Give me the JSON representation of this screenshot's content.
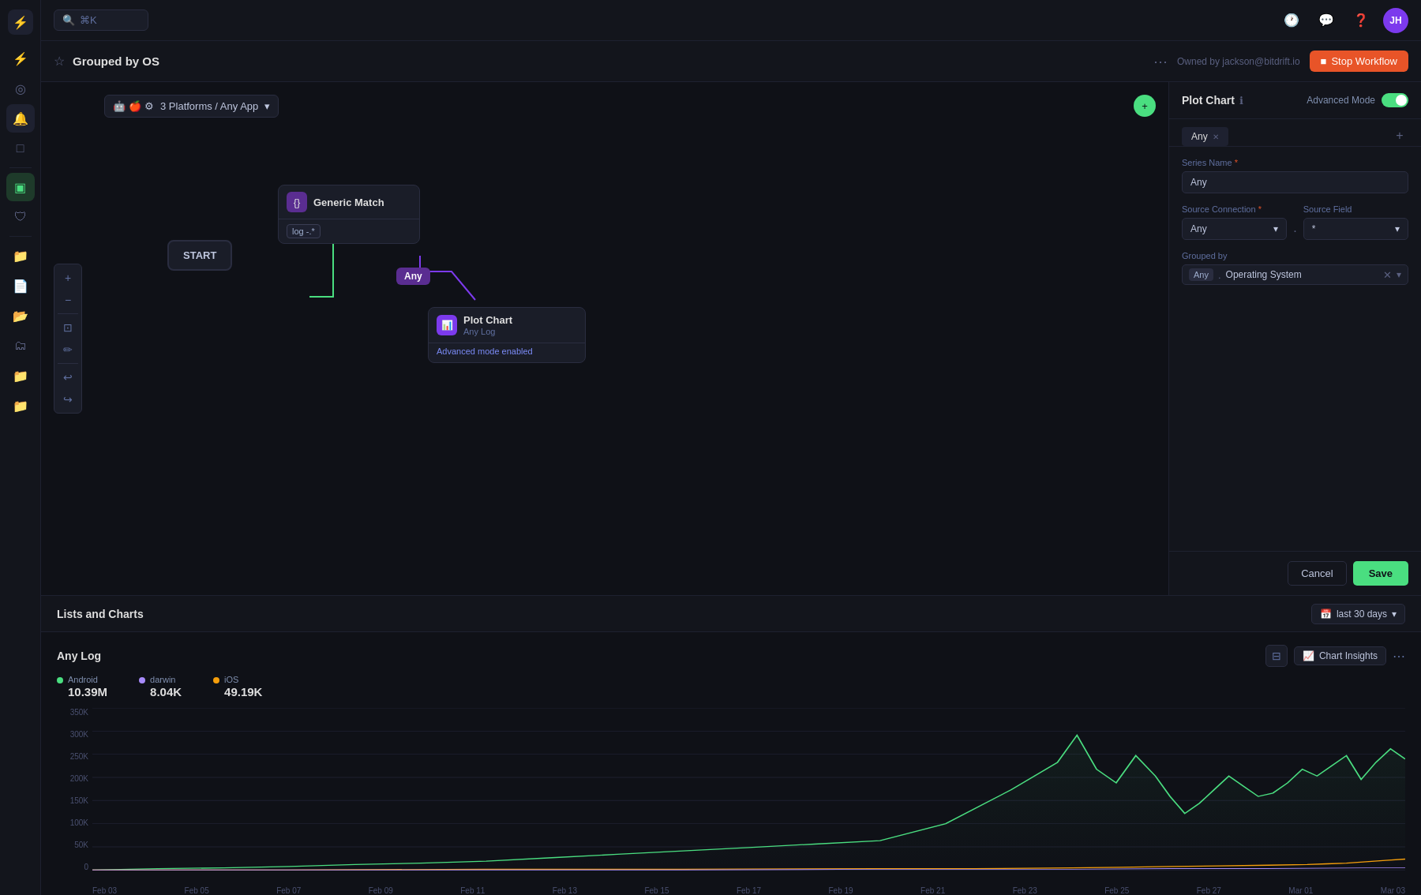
{
  "app": {
    "title": "Grouped by OS",
    "owner": "Owned by jackson@bitdrift.io"
  },
  "topbar": {
    "search_placeholder": "⌘K",
    "avatar_initials": "JH"
  },
  "workflow": {
    "title": "Grouped by OS",
    "owner_label": "Owned by jackson@bitdrift.io",
    "stop_btn_label": "Stop Workflow",
    "platform_selector": "3 Platforms / Any App",
    "nodes": {
      "start": "START",
      "generic_match": {
        "title": "Generic Match",
        "filter": "log  -.*"
      },
      "any_node": "Any",
      "plot_chart": {
        "title": "Plot Chart",
        "subtitle": "Any Log",
        "advanced": "Advanced mode enabled"
      }
    }
  },
  "right_panel": {
    "title": "Plot Chart",
    "advanced_mode_label": "Advanced Mode",
    "tab_label": "Any",
    "series_name_label": "Series Name",
    "series_name_required": "*",
    "series_name_value": "Any",
    "source_connection_label": "Source Connection",
    "source_connection_required": "*",
    "source_connection_value": "Any",
    "source_field_label": "Source Field",
    "source_field_value": "*",
    "grouped_by_label": "Grouped by",
    "grouped_by_prefix": "Any",
    "grouped_by_value": "Operating System",
    "cancel_label": "Cancel",
    "save_label": "Save"
  },
  "bottom": {
    "title": "Lists and Charts",
    "date_range": "last 30 days",
    "chart": {
      "name": "Any Log",
      "legend": [
        {
          "label": "Android",
          "value": "10.39M",
          "color": "#4ade80"
        },
        {
          "label": "darwin",
          "value": "8.04K",
          "color": "#a78bfa"
        },
        {
          "label": "iOS",
          "value": "49.19K",
          "color": "#f59e0b"
        }
      ],
      "y_labels": [
        "350K",
        "300K",
        "250K",
        "200K",
        "150K",
        "100K",
        "50K",
        "0"
      ],
      "x_labels": [
        "Feb 03",
        "Feb 05",
        "Feb 07",
        "Feb 09",
        "Feb 11",
        "Feb 13",
        "Feb 15",
        "Feb 17",
        "Feb 19",
        "Feb 21",
        "Feb 23",
        "Feb 25",
        "Feb 27",
        "Mar 01",
        "Mar 03"
      ]
    }
  },
  "sidebar": {
    "icons": [
      "⚡",
      "🔍",
      "🔔",
      "📁",
      "📄",
      "📂",
      "📁",
      "📁",
      "📁",
      "📁"
    ]
  },
  "icons": {
    "star": "☆",
    "more": "⋯",
    "clock": "🕐",
    "chat": "💬",
    "help": "?",
    "plus": "+",
    "close": "✕",
    "chevron_down": "▾",
    "zoom_in": "+",
    "zoom_out": "−",
    "fit": "⊡",
    "pen": "✏",
    "undo": "↩",
    "redo": "↪",
    "filter": "⊟",
    "chart_insights": "📈",
    "calendar": "📅",
    "menu": "≡",
    "search": "🔍"
  }
}
